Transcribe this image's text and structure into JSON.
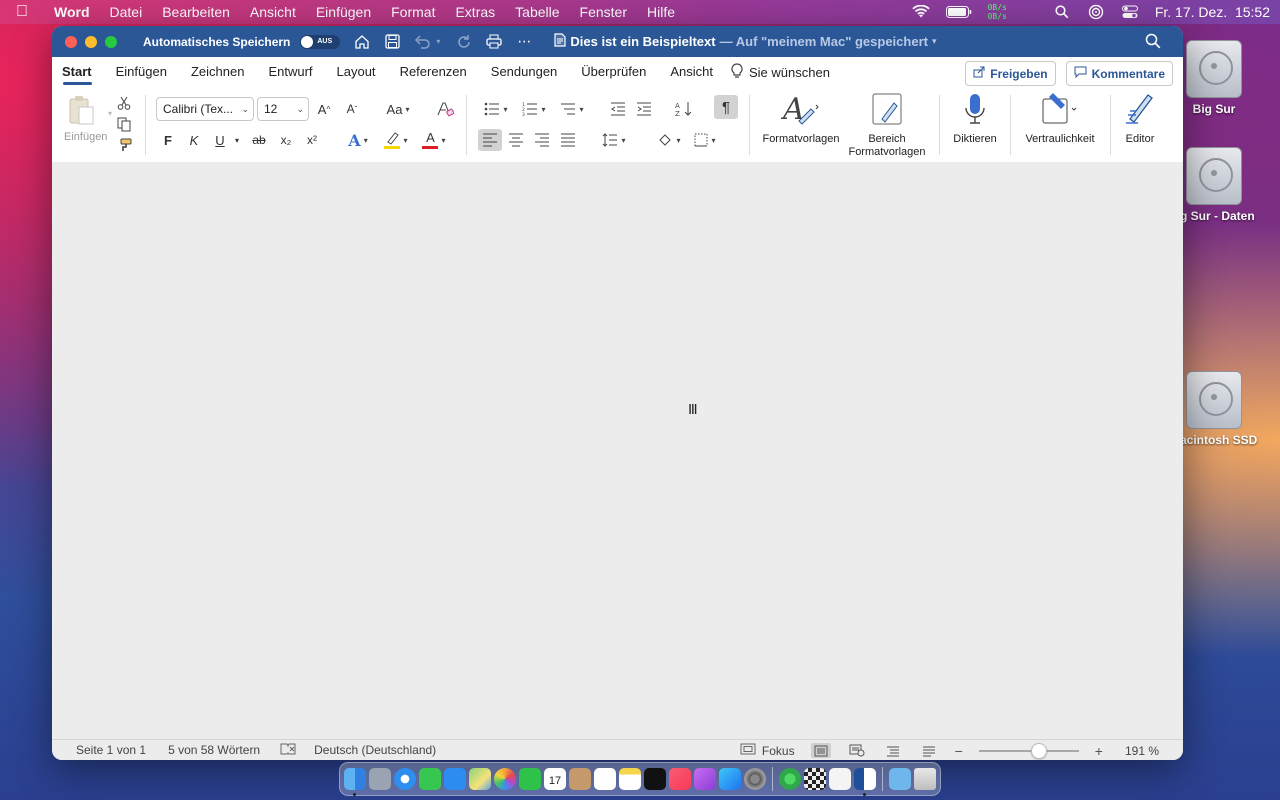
{
  "menubar": {
    "app": "Word",
    "items": [
      "Datei",
      "Bearbeiten",
      "Ansicht",
      "Einfügen",
      "Format",
      "Extras",
      "Tabelle",
      "Fenster",
      "Hilfe"
    ],
    "netspeed_up": "0B/s",
    "netspeed_down": "0B/s",
    "clock": "Fr. 17. Dez.  15:52"
  },
  "window": {
    "autosave_label": "Automatisches Speichern",
    "autosave_state": "AUS",
    "doc_title": "Dies ist ein Beispieltext",
    "doc_location": "— Auf \"meinem Mac\" gespeichert"
  },
  "tabs": [
    "Start",
    "Einfügen",
    "Zeichnen",
    "Entwurf",
    "Layout",
    "Referenzen",
    "Sendungen",
    "Überprüfen",
    "Ansicht"
  ],
  "tell_me": "Sie wünschen",
  "share": {
    "share_label": "Freigeben",
    "comments_label": "Kommentare"
  },
  "ribbon": {
    "paste_label": "Einfügen",
    "font_name": "Calibri (Tex...",
    "font_size": "12",
    "grow": "A^",
    "shrink": "Aˇ",
    "change_case": "Aa",
    "bold": "F",
    "italic": "K",
    "underline": "U",
    "strike": "ab",
    "subscript": "x₂",
    "superscript": "x²",
    "styles_label": "Formatvorlagen",
    "styles_pane_label_1": "Bereich",
    "styles_pane_label_2": "Formatvorlagen",
    "dictate_label": "Diktieren",
    "sensitivity_label": "Vertraulichkeit",
    "editor_label": "Editor",
    "highlight_color": "#f5d800",
    "font_color": "#e02020"
  },
  "status": {
    "page": "Seite 1 von 1",
    "words": "5 von 58 Wörtern",
    "language": "Deutsch (Deutschland)",
    "focus": "Fokus",
    "zoom": "191 %",
    "zoom_level_percent": 191
  },
  "desktop": {
    "icons": [
      "Big Sur",
      "g Sur - Daten",
      "acintosh SSD"
    ]
  },
  "dock": {
    "apps": [
      "finder",
      "launchpad",
      "safari",
      "messages",
      "mail",
      "maps",
      "photos",
      "facetime",
      "calendar",
      "contacts",
      "reminders",
      "notes",
      "tv",
      "music",
      "podcasts",
      "app-store",
      "system-preferences",
      "find-my",
      "chess",
      "textedit",
      "word",
      "downloads",
      "trash"
    ],
    "calendar_day": "17"
  }
}
